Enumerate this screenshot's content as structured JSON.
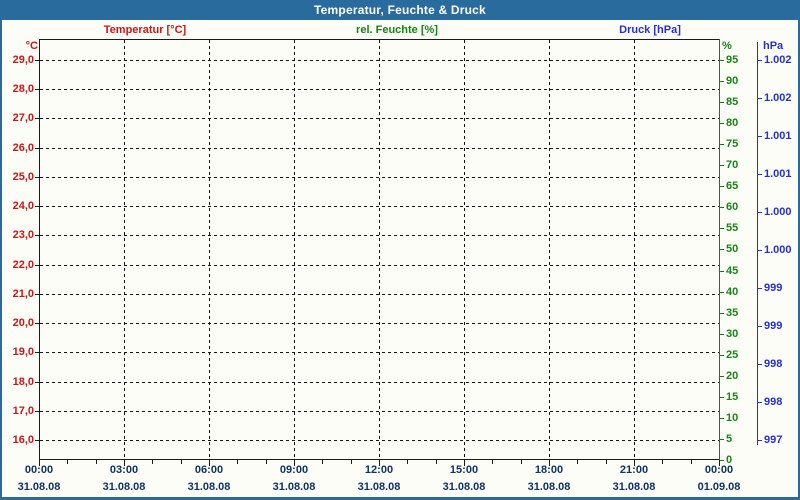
{
  "title": "Temperatur, Feuchte & Druck",
  "legend": {
    "temperature": "Temperatur [°C]",
    "humidity": "rel. Feuchte [%]",
    "pressure": "Druck [hPa]"
  },
  "colors": {
    "titlebar": "#2a6b9d",
    "page_background": "#fdfdf7",
    "temperature": "#cc1616",
    "humidity": "#158515",
    "pressure": "#2531c9",
    "time_text": "#0e3263",
    "grid": "#1a1a1a"
  },
  "axes": {
    "temperature": {
      "unit": "°C",
      "labels": [
        "29,0",
        "28,0",
        "27,0",
        "26,0",
        "25,0",
        "24,0",
        "23,0",
        "22,0",
        "21,0",
        "20,0",
        "19,0",
        "18,0",
        "17,0",
        "16,0"
      ]
    },
    "humidity": {
      "unit": "%",
      "labels": [
        "95",
        "90",
        "85",
        "80",
        "75",
        "70",
        "65",
        "60",
        "55",
        "50",
        "45",
        "40",
        "35",
        "30",
        "25",
        "20",
        "15",
        "10",
        "5",
        "0"
      ]
    },
    "pressure": {
      "unit": "hPa",
      "labels": [
        "1.002",
        "1.002",
        "1.001",
        "1.001",
        "1.000",
        "1.000",
        "999",
        "999",
        "998",
        "998",
        "997"
      ]
    },
    "time": {
      "tick_times": [
        "00:00",
        "03:00",
        "06:00",
        "09:00",
        "12:00",
        "15:00",
        "18:00",
        "21:00",
        "00:00"
      ],
      "tick_dates": [
        "31.08.08",
        "31.08.08",
        "31.08.08",
        "31.08.08",
        "31.08.08",
        "31.08.08",
        "31.08.08",
        "31.08.08",
        "01.09.08"
      ]
    }
  },
  "chart_data": {
    "type": "line",
    "title": "Temperatur, Feuchte & Druck",
    "x_axis": {
      "start": "31.08.08 00:00",
      "end": "01.09.08 00:00",
      "major_tick_interval_hours": 3,
      "minor_tick_interval_hours": 1,
      "tick_times": [
        "00:00",
        "03:00",
        "06:00",
        "09:00",
        "12:00",
        "15:00",
        "18:00",
        "21:00",
        "00:00"
      ],
      "tick_dates": [
        "31.08.08",
        "31.08.08",
        "31.08.08",
        "31.08.08",
        "31.08.08",
        "31.08.08",
        "31.08.08",
        "31.08.08",
        "01.09.08"
      ]
    },
    "y_axes": [
      {
        "name": "Temperatur",
        "unit": "°C",
        "side": "left",
        "color": "#cc1616",
        "tick_values": [
          29.0,
          28.0,
          27.0,
          26.0,
          25.0,
          24.0,
          23.0,
          22.0,
          21.0,
          20.0,
          19.0,
          18.0,
          17.0,
          16.0
        ],
        "tick_labels": [
          "29,0",
          "28,0",
          "27,0",
          "26,0",
          "25,0",
          "24,0",
          "23,0",
          "22,0",
          "21,0",
          "20,0",
          "19,0",
          "18,0",
          "17,0",
          "16,0"
        ],
        "step": 1.0
      },
      {
        "name": "rel. Feuchte",
        "unit": "%",
        "side": "right",
        "color": "#158515",
        "tick_values": [
          95,
          90,
          85,
          80,
          75,
          70,
          65,
          60,
          55,
          50,
          45,
          40,
          35,
          30,
          25,
          20,
          15,
          10,
          5,
          0
        ],
        "range": [
          0,
          100
        ],
        "step": 5
      },
      {
        "name": "Druck",
        "unit": "hPa",
        "side": "right-outer",
        "color": "#2531c9",
        "tick_labels": [
          "1.002",
          "1.002",
          "1.001",
          "1.001",
          "1.000",
          "1.000",
          "999",
          "999",
          "998",
          "998",
          "997"
        ],
        "approx_tick_values": [
          1002.0,
          1001.5,
          1001.0,
          1000.5,
          1000.0,
          999.5,
          999.0,
          998.5,
          998.0,
          997.5,
          997.0
        ],
        "step": 0.5
      }
    ],
    "series": [
      {
        "name": "Temperatur [°C]",
        "color": "#cc1616",
        "points": []
      },
      {
        "name": "rel. Feuchte [%]",
        "color": "#158515",
        "points": []
      },
      {
        "name": "Druck [hPa]",
        "color": "#2531c9",
        "points": []
      }
    ],
    "grid": true,
    "legend_position": "top",
    "note": "Chart area shows gridlines only; no data is plotted for this period."
  }
}
